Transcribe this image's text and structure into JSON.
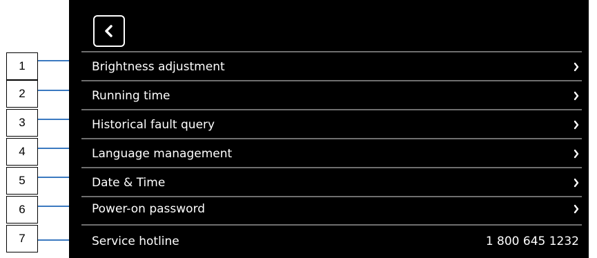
{
  "header": {
    "back_icon": "chevron-left-icon"
  },
  "menu": {
    "items": [
      {
        "callout": "1",
        "label": "Brightness adjustment",
        "icon": "chevron-right-icon"
      },
      {
        "callout": "2",
        "label": "Running time",
        "icon": "chevron-right-icon"
      },
      {
        "callout": "3",
        "label": "Historical fault query",
        "icon": "chevron-right-icon"
      },
      {
        "callout": "4",
        "label": "Language management",
        "icon": "chevron-right-icon"
      },
      {
        "callout": "5",
        "label": "Date & Time",
        "icon": "chevron-right-icon"
      },
      {
        "callout": "6",
        "label": "Power-on password",
        "icon": "chevron-right-icon"
      },
      {
        "callout": "7",
        "label": "Service hotline",
        "value": "1 800 645 1232"
      }
    ]
  },
  "colors": {
    "screen_bg": "#000000",
    "text": "#ffffff",
    "divider": "#6f6f6f",
    "callout_line": "#3a79c0"
  }
}
